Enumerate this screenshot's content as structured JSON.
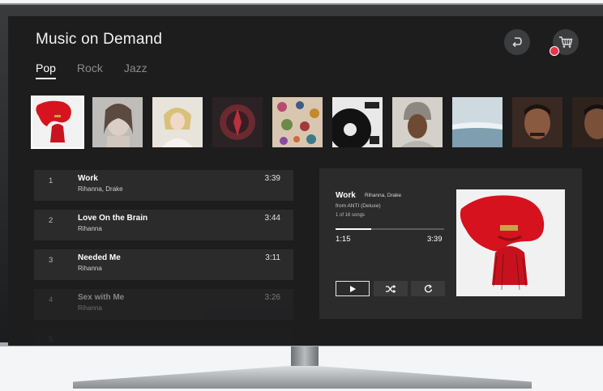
{
  "app": {
    "title": "Music on Demand"
  },
  "tabs": [
    {
      "label": "Pop",
      "active": true
    },
    {
      "label": "Rock",
      "active": false
    },
    {
      "label": "Jazz",
      "active": false
    }
  ],
  "header_buttons": {
    "back_icon": "back-arrow-icon",
    "cart_icon": "cart-icon",
    "cart_badge_color": "#e8354c"
  },
  "albums": [
    {
      "name": "album-1",
      "selected": true
    },
    {
      "name": "album-2"
    },
    {
      "name": "album-3"
    },
    {
      "name": "album-4"
    },
    {
      "name": "album-5"
    },
    {
      "name": "album-6"
    },
    {
      "name": "album-7"
    },
    {
      "name": "album-8"
    },
    {
      "name": "album-9"
    },
    {
      "name": "album-10"
    }
  ],
  "tracks": [
    {
      "num": "1",
      "title": "Work",
      "artist": "Rihanna, Drake",
      "duration": "3:39"
    },
    {
      "num": "2",
      "title": "Love On the Brain",
      "artist": "Rihanna",
      "duration": "3:44"
    },
    {
      "num": "3",
      "title": "Needed Me",
      "artist": "Rihanna",
      "duration": "3:11"
    },
    {
      "num": "4",
      "title": "Sex with Me",
      "artist": "Rihanna",
      "duration": "3:26"
    },
    {
      "num": "5",
      "title": "",
      "artist": "",
      "duration": ""
    }
  ],
  "now_playing": {
    "title": "Work",
    "artist": "Rihanna, Drake",
    "from_prefix": "from",
    "album": "ANTI (Deluxe)",
    "count_prefix": "1",
    "count_suffix": "of 16 songs",
    "elapsed": "1:15",
    "total": "3:39",
    "progress": 0.33,
    "controls": [
      "play-icon",
      "shuffle-icon",
      "repeat-icon"
    ]
  },
  "colors": {
    "background": "#1d1d1e",
    "panel": "#2b2b2c",
    "accent": "#e8354c"
  }
}
